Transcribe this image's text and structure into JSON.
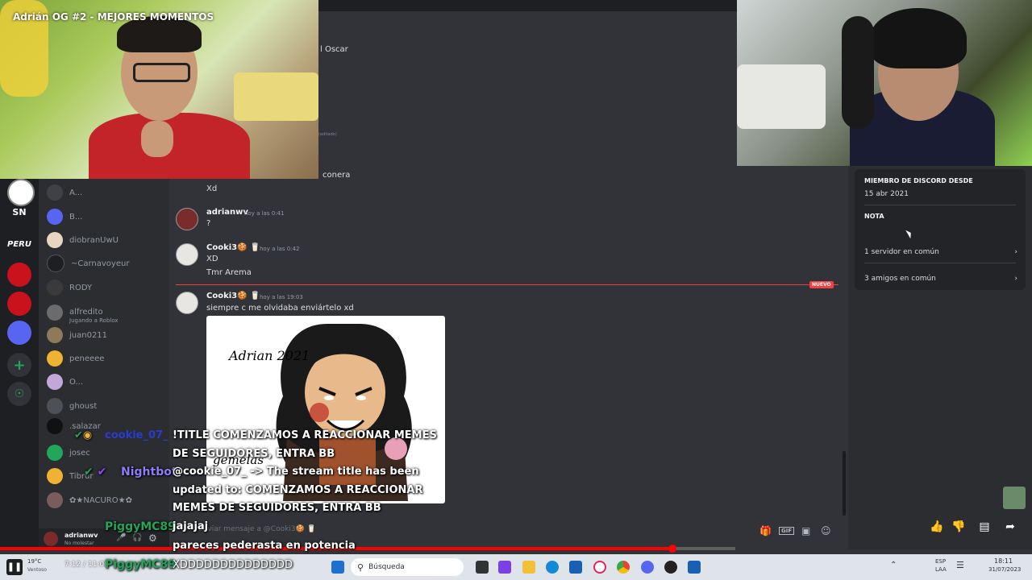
{
  "video": {
    "title": "Adrián OG #2 - MEJORES MOMENTOS"
  },
  "top_area": {
    "partial_name": "l Oscar",
    "tiny_text": "(editado)"
  },
  "server_list": {
    "items": [
      {
        "label": "SN"
      },
      {
        "label": "PERU"
      }
    ]
  },
  "members": [
    {
      "name": "A...",
      "color": "#3f4147"
    },
    {
      "name": "B...",
      "color": "#5865f2"
    },
    {
      "name": "diobranUwU",
      "color": "#e9d6c2"
    },
    {
      "name": "~Carnavoyeur",
      "color": "#1e1f22"
    },
    {
      "name": "RODY",
      "color": "#3a3a3a"
    },
    {
      "name": "alfredito",
      "sub": "Jugando a Roblox",
      "color": "#6b6b6b"
    },
    {
      "name": "juan0211",
      "color": "#8c7a5a"
    },
    {
      "name": "peneeee",
      "color": "#f0b232"
    },
    {
      "name": "O...",
      "color": "#c3a7d9"
    },
    {
      "name": "ghoust",
      "color": "#4e5058"
    },
    {
      "name": ".salazar",
      "color": "#111111"
    },
    {
      "name": "josec",
      "color": "#23a55a"
    },
    {
      "name": "Tibrur",
      "color": "#f0b232"
    },
    {
      "name": "✿★NACURO★✿",
      "color": "#7a5c5c"
    }
  ],
  "chat": {
    "partial_prev_line": "conera",
    "partial_prev_text": "Xd",
    "messages": [
      {
        "user": "adrianwv",
        "time": "hoy a las 0:41",
        "lines": [
          "?"
        ]
      },
      {
        "user": "Cooki3🍪 🥛",
        "time": "hoy a las 0:42",
        "lines": [
          "XD",
          "Tmr Arema"
        ]
      },
      {
        "user": "Cooki3🍪 🥛",
        "time": "hoy a las 19:03",
        "lines": [
          "siempre c me olvidaba enviártelo xd"
        ]
      }
    ],
    "new_badge": "NUEVO",
    "image_caption": "Adrian 2021",
    "image_caption2": "gemelas"
  },
  "composer": {
    "placeholder": "Enviar mensaje a @Cooki3🍪 🥛"
  },
  "user_panel": {
    "username": "adrianwv",
    "status": "No molestar"
  },
  "profile_panel": {
    "member_since_label": "MIEMBRO DE DISCORD DESDE",
    "member_since_value": "15 abr 2021",
    "note_label": "NOTA",
    "mutual_servers": "1 servidor en común",
    "mutual_friends": "3 amigos en común"
  },
  "stream_overlay": {
    "user1": "cookie_07_",
    "line1": "!TITLE COMENZAMOS A REACCIONAR MEMES",
    "line2": "DE SEGUIDORES, ENTRA BB",
    "bot": "Nightbot",
    "line3": "@cookie_07_ -> The stream title has been",
    "line4": "updated to: COMENZAMOS A REACCIONAR",
    "line5": "MEMES DE SEGUIDORES, ENTRA BB",
    "user2": "PiggyMC89",
    "line6": "jajajaj",
    "line7": "pareces pederasta en potencia",
    "user3": "PiggyMC89",
    "line8": "XDDDDDDDDDDDDDD"
  },
  "player": {
    "progress_fraction": 0.915,
    "time": "7:12 / 11:00"
  },
  "taskbar": {
    "search_placeholder": "Búsqueda",
    "weather_temp": "19°C",
    "weather_desc": "Ventoso",
    "lang_top": "ESP",
    "lang_bottom": "LAA",
    "clock_time": "18:11",
    "clock_date": "31/07/2023"
  },
  "colors": {
    "discord_bg": "#313338",
    "sidebar_bg": "#2b2d31",
    "accent_red": "#f23f43",
    "taskbar_bg": "#dfe3ea"
  }
}
